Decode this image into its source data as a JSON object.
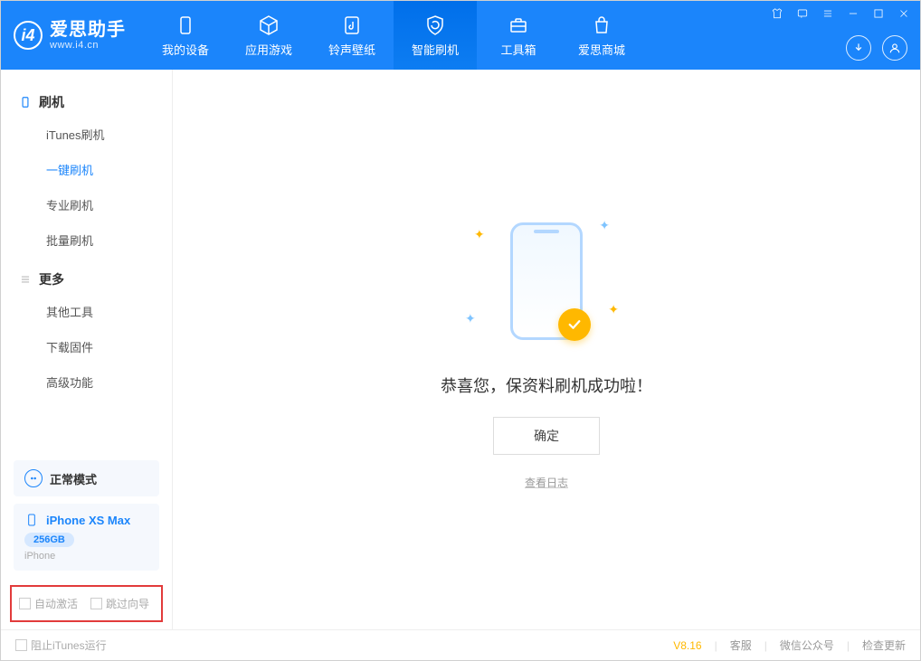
{
  "app": {
    "name": "爱思助手",
    "url": "www.i4.cn"
  },
  "nav": {
    "items": [
      {
        "label": "我的设备",
        "icon": "device"
      },
      {
        "label": "应用游戏",
        "icon": "cube"
      },
      {
        "label": "铃声壁纸",
        "icon": "music"
      },
      {
        "label": "智能刷机",
        "icon": "refresh",
        "active": true
      },
      {
        "label": "工具箱",
        "icon": "toolbox"
      },
      {
        "label": "爱思商城",
        "icon": "bag"
      }
    ]
  },
  "sidebar": {
    "group1": {
      "title": "刷机",
      "items": [
        "iTunes刷机",
        "一键刷机",
        "专业刷机",
        "批量刷机"
      ],
      "activeIndex": 1
    },
    "group2": {
      "title": "更多",
      "items": [
        "其他工具",
        "下载固件",
        "高级功能"
      ]
    },
    "mode": "正常模式",
    "device": {
      "name": "iPhone XS Max",
      "capacity": "256GB",
      "type": "iPhone"
    },
    "options": {
      "autoActivate": "自动激活",
      "skipGuide": "跳过向导"
    }
  },
  "main": {
    "successText": "恭喜您，保资料刷机成功啦！",
    "okButton": "确定",
    "viewLog": "查看日志"
  },
  "footer": {
    "blockItunes": "阻止iTunes运行",
    "version": "V8.16",
    "support": "客服",
    "wechat": "微信公众号",
    "checkUpdate": "检查更新"
  }
}
